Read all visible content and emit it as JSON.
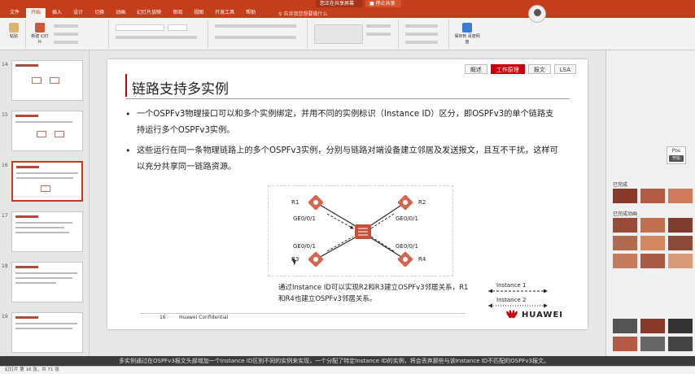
{
  "titlebar": {
    "share_status": "您正在共享屏幕",
    "stop_share": "■ 停止共享"
  },
  "ribbon_tabs": [
    "文件",
    "开始",
    "插入",
    "设计",
    "切换",
    "动画",
    "幻灯片放映",
    "审阅",
    "视图",
    "开发工具",
    "帮助"
  ],
  "active_tab_index": 1,
  "tell_me": "♀ 告诉我您想要做什么",
  "ribbon_buttons": {
    "paste": "粘贴",
    "new_slide": "新建\n幻灯片",
    "save_to_cloud": "保存到\n百度网盘"
  },
  "thumbnails": [
    {
      "num": "14"
    },
    {
      "num": "15"
    },
    {
      "num": "16"
    },
    {
      "num": "17"
    },
    {
      "num": "18"
    },
    {
      "num": "19"
    }
  ],
  "active_thumbnail": 2,
  "slide": {
    "title": "链路支持多实例",
    "nav_tabs": [
      {
        "label": "概述",
        "active": false
      },
      {
        "label": "工作原理",
        "active": true
      },
      {
        "label": "报文",
        "active": false
      },
      {
        "label": "LSA",
        "active": false
      }
    ],
    "bullets": [
      "一个OSPFv3物理接口可以和多个实例绑定，并用不同的实例标识（Instance ID）区分，即OSPFv3的单个链路支持运行多个OSPFv3实例。",
      "这些运行在同一条物理链路上的多个OSPFv3实例，分别与链路对端设备建立邻居及发送报文，且互不干扰，这样可以充分共享同一链路资源。"
    ],
    "diagram": {
      "routers": [
        "R1",
        "R2",
        "R3",
        "R4"
      ],
      "interfaces": [
        "GE0/0/1",
        "GE0/0/1",
        "GE0/0/1",
        "GE0/0/1"
      ]
    },
    "caption": "通过Instance ID可以实现R2和R3建立OSPFv3邻居关系，R1和R4也建立OSPFv3邻居关系。",
    "legend": [
      "Instance 1",
      "Instance 2"
    ],
    "footer_page": "16",
    "footer_confidential": "Huawei Confidential",
    "brand": "HUAWEI"
  },
  "right_panel": {
    "head1": "已完成",
    "head2": "已完成动画",
    "float_label": "Pos",
    "float_btn": "开始"
  },
  "notes_text": "多实例通过在OSPFv3报文头部增加一个Instance ID区别不同的实例来实现，一个分配了特定Instance ID的实例，将会丢弃那些与该Instance ID不匹配的OSPFv3报文。",
  "status_text": "幻灯片 第 16 张，共 71 张"
}
